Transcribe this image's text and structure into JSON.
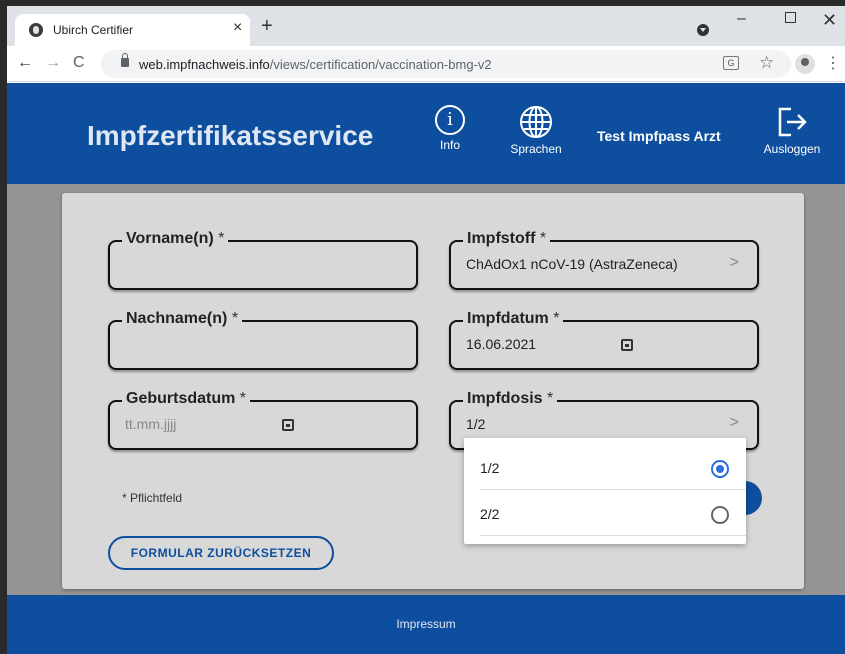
{
  "browser": {
    "tab_title": "Ubirch Certifier",
    "tab_close": "×",
    "new_tab": "+",
    "url_host": "web.impfnachweis.info",
    "url_path": "/views/certification/vaccination-bmg-v2",
    "win_min": "–",
    "win_close": "✕",
    "back": "←",
    "forward": "→",
    "reload": "C",
    "star": "☆",
    "menu": "⋮"
  },
  "header": {
    "brand": "Impfzertifikatsservice",
    "info_label": "Info",
    "info_glyph": "i",
    "lang_label": "Sprachen",
    "user_name": "Test Impfpass Arzt",
    "logout_label": "Ausloggen"
  },
  "form": {
    "required_marker": "*",
    "first_name": {
      "label": "Vorname(n)",
      "value": ""
    },
    "last_name": {
      "label": "Nachname(n)",
      "value": ""
    },
    "birth_date": {
      "label": "Geburtsdatum",
      "placeholder": "tt.mm.jjjj"
    },
    "vaccine": {
      "label": "Impfstoff",
      "value": "ChAdOx1 nCoV-19 (AstraZeneca)"
    },
    "vaccination_date": {
      "label": "Impfdatum",
      "value": "16.06.2021"
    },
    "dose": {
      "label": "Impfdosis",
      "value": "1/2"
    },
    "required_note": "*   Pflichtfeld",
    "reset_label": "FORMULAR ZURÜCKSETZEN",
    "chevron": ">"
  },
  "dose_menu": {
    "options": [
      {
        "label": "1/2",
        "selected": true
      },
      {
        "label": "2/2",
        "selected": false
      }
    ]
  },
  "footer": {
    "impressum": "Impressum"
  },
  "colors": {
    "primary": "#0d4f9e",
    "radio_selected": "#2a6fe0",
    "backdrop": "#949494"
  }
}
